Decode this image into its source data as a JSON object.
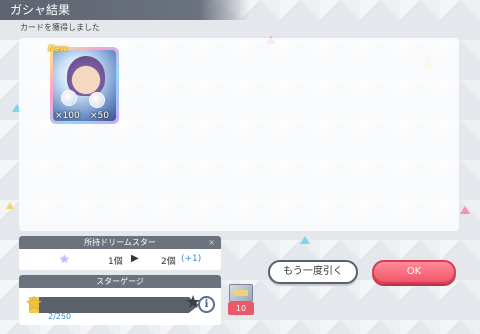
{
  "header": {
    "title": "ガシャ結果"
  },
  "subtitle": "カードを獲得しました",
  "card": {
    "new_label": "New",
    "count_left": "×100",
    "count_right": "×50"
  },
  "stars": {
    "title": "所持ドリームスター",
    "close": "×",
    "before": "1個",
    "arrow": "▶",
    "after": "2個",
    "diff": "(+1)"
  },
  "gauge": {
    "title": "スターゲージ",
    "value_text": "2/250",
    "current": 2,
    "max": 250,
    "info": "i"
  },
  "ticket": {
    "count": "10"
  },
  "buttons": {
    "retry": "もう一度引く",
    "ok": "OK"
  },
  "colors": {
    "accent_ok": "#f0566a",
    "header_bg": "#5d6470",
    "gauge_fill": "#f2c94c",
    "diff_text": "#3a8fd6"
  }
}
